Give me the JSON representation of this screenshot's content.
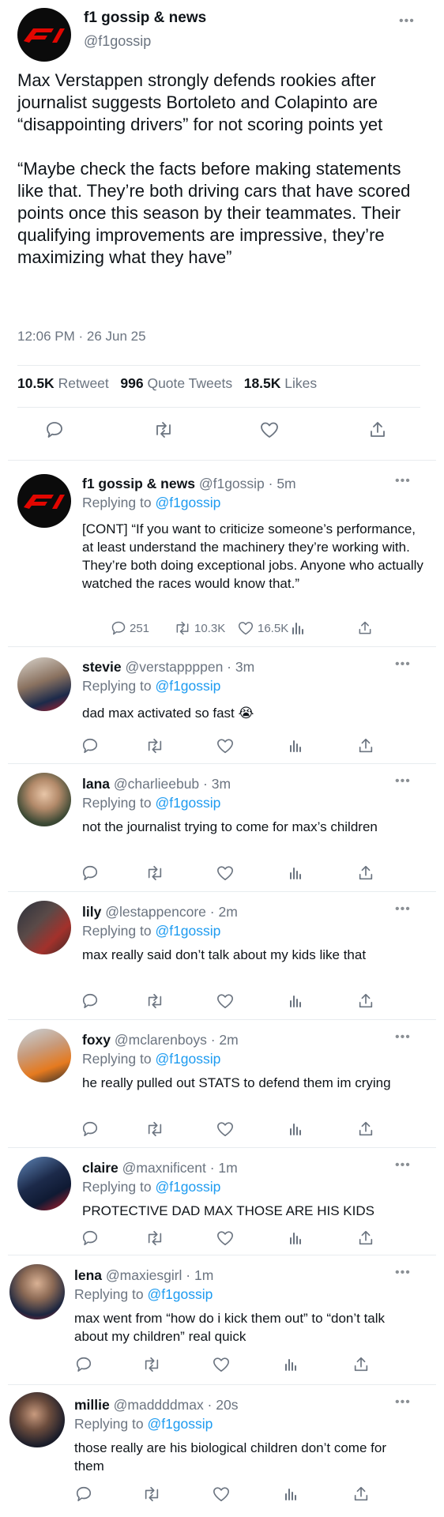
{
  "main": {
    "name": "f1 gossip & news",
    "handle": "@f1gossip",
    "text": "Max Verstappen strongly defends rookies after journalist suggests Bortoleto and Colapinto are “disappointing drivers” for not scoring points yet\n\n“Maybe check the facts before making statements like that. They’re both driving cars that have scored points once this season by their teammates. Their qualifying improvements are impressive, they’re maximizing what they have”",
    "timestamp": "12:06 PM · 26 Jun 25",
    "retweets_count": "10.5K",
    "retweets_label": "Retweet",
    "quotes_count": "996",
    "quotes_label": "Quote Tweets",
    "likes_count": "18.5K",
    "likes_label": "Likes"
  },
  "replies": [
    {
      "name": "f1 gossip & news",
      "handle": "@f1gossip · 5m",
      "replying_label": "Replying to",
      "replying_to": "@f1gossip",
      "text": "[CONT] “If you want to criticize someone’s performance, at least understand the machinery they’re working with. They’re both doing exceptional jobs. Anyone who actually watched the races would know that.”",
      "reply_count": "251",
      "retweet_count": "10.3K",
      "like_count": "16.5K"
    },
    {
      "name": "stevie",
      "handle": "@verstappppen · 3m",
      "replying_label": "Replying to",
      "replying_to": "@f1gossip",
      "text": "dad max activated so fast 😭"
    },
    {
      "name": "lana",
      "handle": "@charlieebub · 3m",
      "replying_label": "Replying to",
      "replying_to": "@f1gossip",
      "text": "not the journalist trying to come for max’s children"
    },
    {
      "name": "lily",
      "handle": "@lestappencore · 2m",
      "replying_label": "Replying to",
      "replying_to": "@f1gossip",
      "text": "max really said don’t talk about my kids like that"
    },
    {
      "name": "foxy",
      "handle": "@mclarenboys · 2m",
      "replying_label": "Replying to",
      "replying_to": "@f1gossip",
      "text": "he really pulled out STATS to defend them im crying"
    },
    {
      "name": "claire",
      "handle": "@maxnificent · 1m",
      "replying_label": "Replying to",
      "replying_to": "@f1gossip",
      "text": "PROTECTIVE DAD MAX THOSE ARE HIS KIDS"
    },
    {
      "name": "lena",
      "handle": "@maxiesgirl · 1m",
      "replying_label": "Replying to",
      "replying_to": "@f1gossip",
      "text": "max went from “how do i kick them out” to “don’t talk about my children” real quick"
    },
    {
      "name": "millie",
      "handle": "@maddddmax · 20s",
      "replying_label": "Replying to",
      "replying_to": "@f1gossip",
      "text": "those really are his biological children don’t come for them"
    }
  ],
  "icons": {
    "more": "more-icon",
    "reply": "reply-icon",
    "retweet": "retweet-icon",
    "like": "like-icon",
    "share": "share-icon",
    "analytics": "analytics-icon"
  },
  "colors": {
    "accent": "#1d9bf0",
    "muted": "#6b7480",
    "logo_red": "#e10600"
  }
}
